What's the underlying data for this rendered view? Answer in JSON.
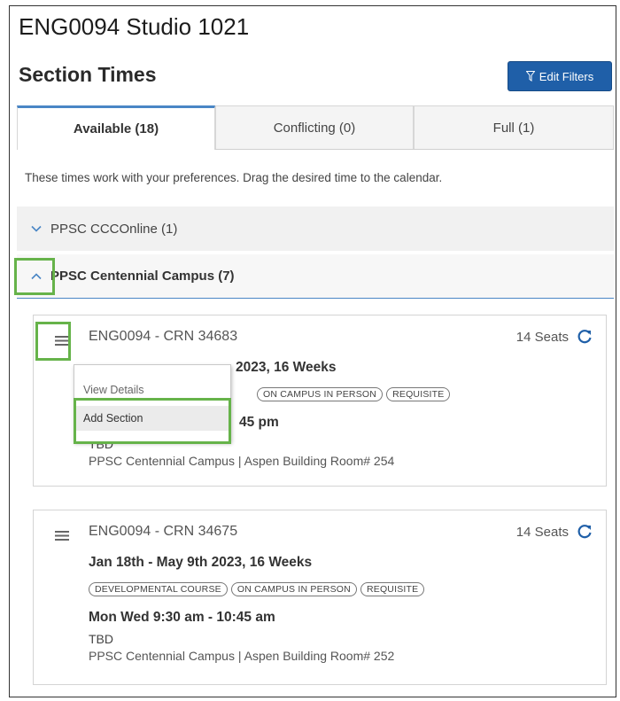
{
  "course": {
    "title": "ENG0094 Studio 1021"
  },
  "section_times": {
    "heading": "Section Times",
    "edit_filters_label": "Edit Filters"
  },
  "tabs": [
    {
      "label": "Available (18)",
      "active": true
    },
    {
      "label": "Conflicting (0)",
      "active": false
    },
    {
      "label": "Full (1)",
      "active": false
    }
  ],
  "hint": "These times work with your preferences. Drag the desired time to the calendar.",
  "groups": [
    {
      "label": "PPSC CCCOnline (1)",
      "expanded": false
    },
    {
      "label": "PPSC Centennial Campus (7)",
      "expanded": true
    }
  ],
  "sections": [
    {
      "crn_label": "ENG0094 - CRN 34683",
      "seats": "14 Seats",
      "dates_visible": "2023, 16 Weeks",
      "badges_visible": [
        "On Campus In Person",
        "Requisite"
      ],
      "times_visible": "45 pm",
      "instructor": "TBD",
      "location": "PPSC Centennial Campus | Aspen Building Room# 254"
    },
    {
      "crn_label": "ENG0094 - CRN 34675",
      "seats": "14 Seats",
      "dates": "Jan 18th - May 9th 2023, 16 Weeks",
      "badges": [
        "Developmental Course",
        "On Campus In Person",
        "Requisite"
      ],
      "times": "Mon Wed 9:30 am - 10:45 am",
      "instructor": "TBD",
      "location": "PPSC Centennial Campus | Aspen Building Room# 252"
    }
  ],
  "context_menu": {
    "items": [
      "View Details",
      "Add Section"
    ],
    "selected": "Add Section"
  },
  "icons": {
    "filter": "filter-icon",
    "chevron_down": "chevron-down-icon",
    "chevron_up": "chevron-up-icon",
    "menu": "hamburger-menu-icon",
    "refresh": "refresh-icon"
  },
  "colors": {
    "primary_button": "#1f5fa8",
    "tab_accent": "#4a86c5",
    "highlight": "#66b34a",
    "chevron": "#4a86c5"
  }
}
